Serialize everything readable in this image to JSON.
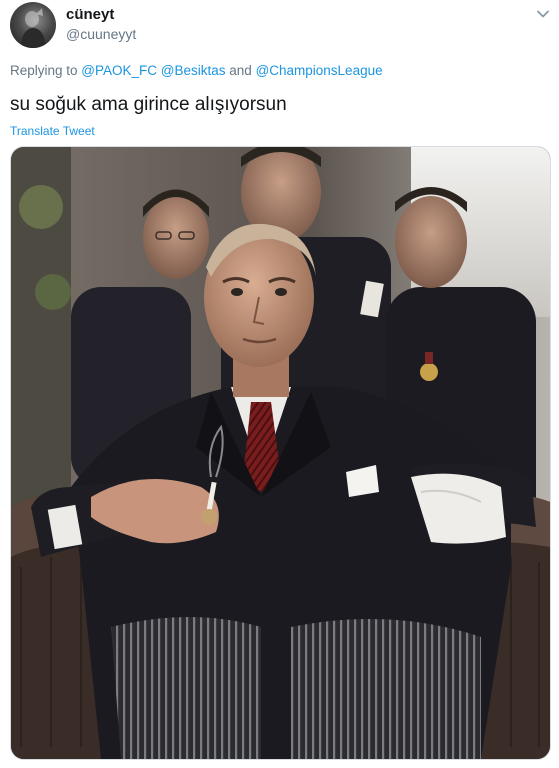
{
  "tweet": {
    "author": {
      "display_name": "cüneyt",
      "handle": "@cuuneyyt"
    },
    "reply": {
      "prefix": "Replying to ",
      "mention_1": "@PAOK_FC",
      "separator_1": " ",
      "mention_2": "@Besiktas",
      "separator_2": " and ",
      "mention_3": "@ChampionsLeague"
    },
    "text": "su soğuk ama girince alışıyorsun",
    "translate_label": "Translate Tweet"
  },
  "colors": {
    "link_blue": "#1b95e0",
    "secondary_text": "#657786"
  }
}
